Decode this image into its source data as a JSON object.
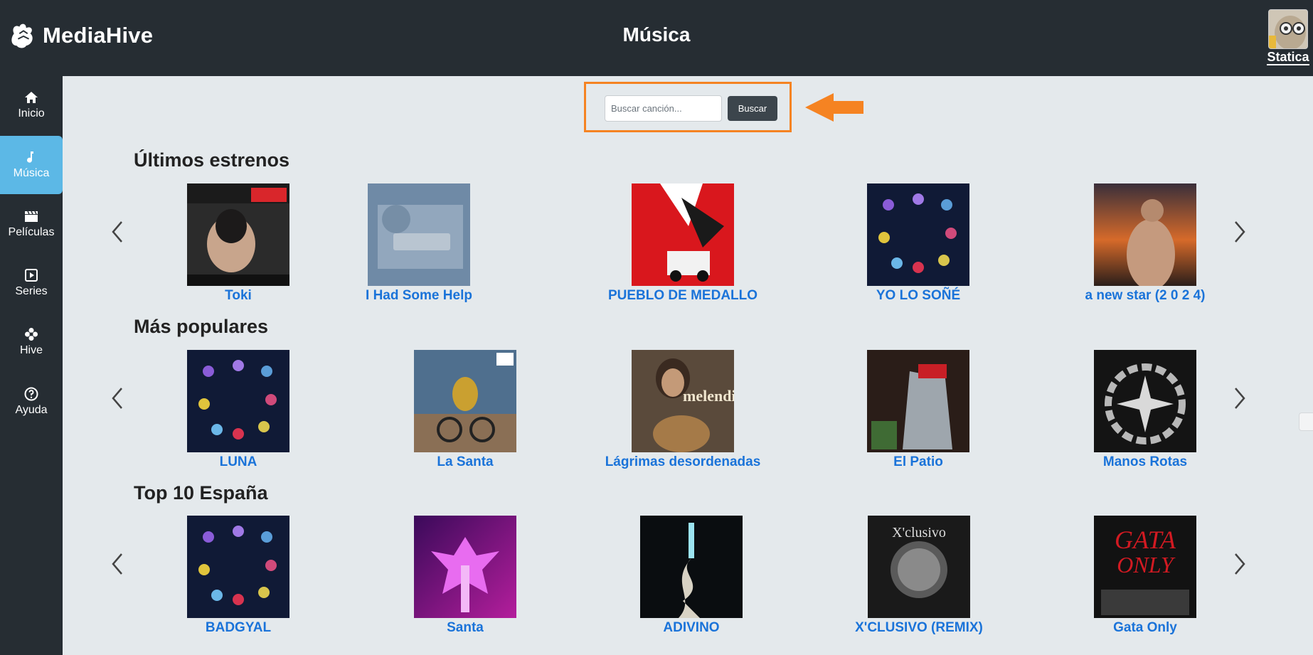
{
  "header": {
    "brand": "MediaHive",
    "title": "Música",
    "user": "Statica"
  },
  "sidebar": {
    "items": [
      {
        "label": "Inicio",
        "icon": "home-icon"
      },
      {
        "label": "Música",
        "icon": "music-note-icon",
        "active": true
      },
      {
        "label": "Películas",
        "icon": "clapperboard-icon"
      },
      {
        "label": "Series",
        "icon": "play-square-icon"
      },
      {
        "label": "Hive",
        "icon": "flower-icon"
      },
      {
        "label": "Ayuda",
        "icon": "help-circle-icon"
      }
    ]
  },
  "search": {
    "placeholder": "Buscar canción...",
    "button": "Buscar",
    "highlight_color": "#f58322"
  },
  "sections": [
    {
      "title": "Últimos estrenos",
      "items": [
        "Toki",
        "I Had Some Help",
        "PUEBLO DE MEDALLO",
        "YO LO SOÑÉ",
        "a new star (2 0 2 4)"
      ]
    },
    {
      "title": "Más populares",
      "items": [
        "LUNA",
        "La Santa",
        "Lágrimas desordenadas",
        "El Patio",
        "Manos Rotas"
      ]
    },
    {
      "title": "Top 10 España",
      "items": [
        "BADGYAL",
        "Santa",
        "ADIVINO",
        "X'CLUSIVO (REMIX)",
        "Gata Only"
      ]
    }
  ],
  "colors": {
    "accent": "#5cb8e6",
    "dark": "#262d33",
    "link": "#1a73d9",
    "background": "#e4e9ec"
  }
}
